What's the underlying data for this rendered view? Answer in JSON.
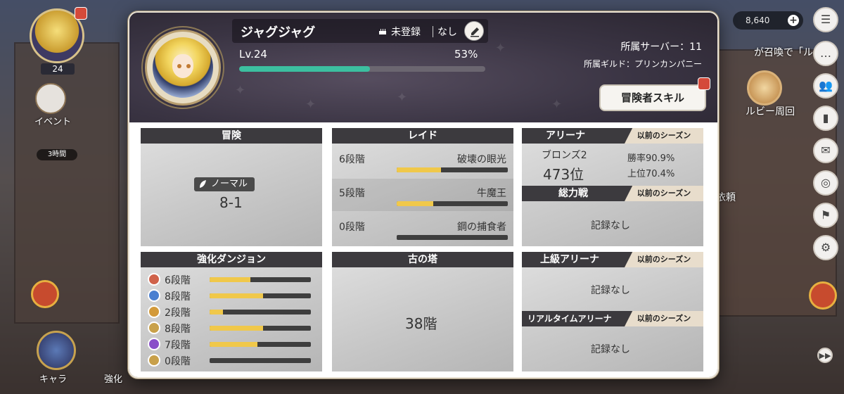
{
  "hud": {
    "player_level": "24",
    "event_label": "イベント",
    "event_time": "3時間",
    "chara_label": "キャラ",
    "enhance_label": "強化",
    "currency_value": "8,640",
    "summon_text": "が召喚で「ルリ",
    "ruby_label": "ルビー周回",
    "request_label": "依頼"
  },
  "profile": {
    "name": "ジャグジャグ",
    "birthday": "未登録",
    "guild_status": "なし",
    "level": "Lv.24",
    "exp_percent_text": "53%",
    "exp_percent": 53,
    "server": "所属サーバー：11",
    "guild": "所属ギルド：プリンカンパニー",
    "skill_button": "冒険者スキル"
  },
  "cards": {
    "adventure": {
      "title": "冒険",
      "difficulty": "ノーマル",
      "stage": "8-1"
    },
    "raid": {
      "title": "レイド",
      "rows": [
        {
          "stage": "6段階",
          "boss": "破壊の眼光",
          "progress": 40
        },
        {
          "stage": "5段階",
          "boss": "牛魔王",
          "progress": 33
        },
        {
          "stage": "0段階",
          "boss": "鋼の捕食者",
          "progress": 0
        }
      ]
    },
    "arena": {
      "title": "アリーナ",
      "season": "以前のシーズン",
      "tier": "ブロンズ2",
      "rank": "473位",
      "win_rate": "勝率90.9%",
      "top": "上位70.4%"
    },
    "total_war": {
      "title": "総力戦",
      "season": "以前のシーズン",
      "record": "記録なし"
    },
    "dungeon": {
      "title": "強化ダンジョン",
      "rows": [
        {
          "stage": "6段階",
          "progress": 40,
          "color": "#d0624a"
        },
        {
          "stage": "8段階",
          "progress": 53,
          "color": "#4a7fd0"
        },
        {
          "stage": "2段階",
          "progress": 13,
          "color": "#d39a3a"
        },
        {
          "stage": "8段階",
          "progress": 53,
          "color": "#c9a14a"
        },
        {
          "stage": "7段階",
          "progress": 47,
          "color": "#8a4fc9"
        },
        {
          "stage": "0段階",
          "progress": 0,
          "color": "#c8a04a"
        }
      ]
    },
    "tower": {
      "title": "古の塔",
      "floor": "38階"
    },
    "upper_arena": {
      "title": "上級アリーナ",
      "season": "以前のシーズン",
      "record": "記録なし"
    },
    "realtime_arena": {
      "title": "リアルタイムアリーナ",
      "season": "以前のシーズン",
      "record": "記録なし"
    }
  },
  "colors": {
    "exp_bar": "#3cbfa0",
    "progress_bar": "#f0c84a",
    "header_bg": "#3c3a3e"
  }
}
